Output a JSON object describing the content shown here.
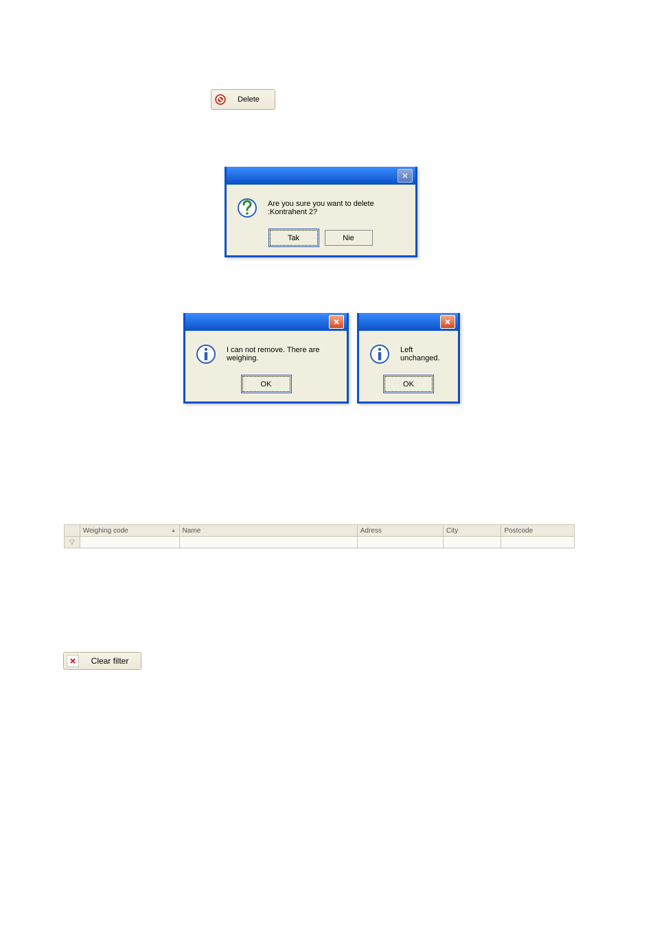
{
  "delete_button": {
    "label": "Delete"
  },
  "confirm_dialog": {
    "message": "Are you sure you want to delete :Kontrahent 2?",
    "yes": "Tak",
    "no": "Nie"
  },
  "info_dialog_1": {
    "message": "I can not remove. There are weighing.",
    "ok": "OK"
  },
  "info_dialog_2": {
    "message": "Left unchanged.",
    "ok": "OK"
  },
  "grid": {
    "columns": {
      "weighing_code": "Weighing code",
      "name": "Name",
      "adress": "Adress",
      "city": "City",
      "postcode": "Postcode"
    },
    "filter_row_indicator": "▽"
  },
  "clear_filter_button": {
    "label": "Clear filter"
  }
}
